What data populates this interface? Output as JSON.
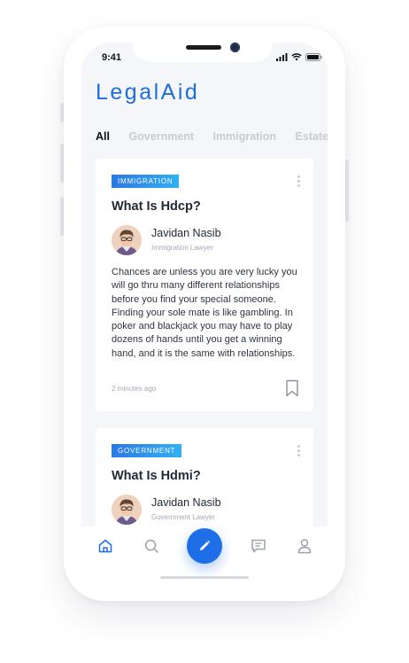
{
  "status_bar": {
    "time": "9:41"
  },
  "app": {
    "title": "LegalAid",
    "accent_color": "#1e6fd9"
  },
  "tabs": [
    {
      "label": "All",
      "active": true
    },
    {
      "label": "Government",
      "active": false
    },
    {
      "label": "Immigration",
      "active": false
    },
    {
      "label": "Estate",
      "active": false
    }
  ],
  "cards": [
    {
      "category": "IMMIGRATION",
      "title": "What Is Hdcp?",
      "author": "Javidan Nasib",
      "role": "Immigration Lawyer",
      "body": "Chances are unless you are very lucky you will go thru many different relationships before you find your special someone. Finding your sole mate is like gambling. In poker and blackjack you may have to play dozens of hands until you get a winning hand, and it is the same with relationships.",
      "time_ago": "2 minutes ago"
    },
    {
      "category": "GOVERNMENT",
      "title": "What Is Hdmi?",
      "author": "Javidan Nasib",
      "role": "Government Lawyer"
    }
  ],
  "nav": [
    {
      "icon": "home-icon",
      "active": true
    },
    {
      "icon": "search-icon",
      "active": false
    },
    {
      "icon": "pencil-icon",
      "active": false
    },
    {
      "icon": "chat-icon",
      "active": false
    },
    {
      "icon": "profile-icon",
      "active": false
    }
  ]
}
